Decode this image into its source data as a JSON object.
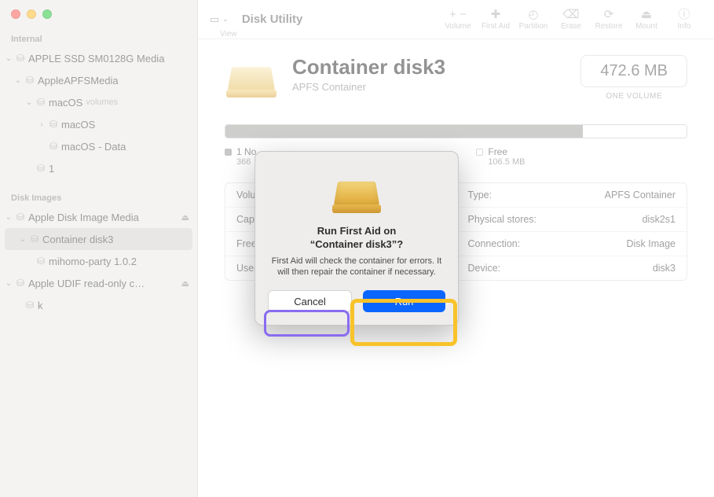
{
  "app_title": "Disk Utility",
  "toolbar": {
    "view_label": "View",
    "items": [
      {
        "id": "volume",
        "label": "Volume",
        "glyph": "+  −"
      },
      {
        "id": "firstaid",
        "label": "First Aid",
        "glyph": "✚"
      },
      {
        "id": "partition",
        "label": "Partition",
        "glyph": "◴"
      },
      {
        "id": "erase",
        "label": "Erase",
        "glyph": "⌫"
      },
      {
        "id": "restore",
        "label": "Restore",
        "glyph": "⟳"
      },
      {
        "id": "mount",
        "label": "Mount",
        "glyph": "⏏"
      },
      {
        "id": "info",
        "label": "Info",
        "glyph": "ⓘ"
      }
    ]
  },
  "sidebar": {
    "internal_label": "Internal",
    "disk_images_label": "Disk Images",
    "internal_items": [
      {
        "label": "APPLE SSD SM0128G Media",
        "indent": 0,
        "has_chev": true,
        "chev": "⌄",
        "ejectable": false,
        "selected": false
      },
      {
        "label": "AppleAPFSMedia",
        "indent": 1,
        "has_chev": true,
        "chev": "⌄",
        "ejectable": false,
        "selected": false
      },
      {
        "label": "macOS",
        "indent": 2,
        "has_chev": true,
        "chev": "⌄",
        "ejectable": false,
        "selected": false,
        "suffix": "volumes"
      },
      {
        "label": "macOS",
        "indent": 3,
        "has_chev": true,
        "chev": "›",
        "ejectable": false,
        "selected": false
      },
      {
        "label": "macOS - Data",
        "indent": 3,
        "has_chev": false,
        "chev": "",
        "ejectable": false,
        "selected": false
      },
      {
        "label": "1",
        "indent": 2,
        "has_chev": false,
        "chev": "",
        "ejectable": false,
        "selected": false
      }
    ],
    "image_items": [
      {
        "label": "Apple Disk Image Media",
        "indent": 0,
        "has_chev": true,
        "chev": "⌄",
        "ejectable": true,
        "selected": false
      },
      {
        "label": "Container disk3",
        "indent": 1,
        "has_chev": true,
        "chev": "⌄",
        "ejectable": false,
        "selected": true
      },
      {
        "label": "mihomo-party 1.0.2",
        "indent": 2,
        "has_chev": false,
        "chev": "",
        "ejectable": false,
        "selected": false
      },
      {
        "label": "Apple UDIF read-only c…",
        "indent": 0,
        "has_chev": true,
        "chev": "⌄",
        "ejectable": true,
        "selected": false
      },
      {
        "label": "k",
        "indent": 1,
        "has_chev": false,
        "chev": "",
        "ejectable": false,
        "selected": false
      }
    ]
  },
  "disk": {
    "name": "Container disk3",
    "subtitle": "APFS Container",
    "size_label": "472.6 MB",
    "volume_count_label": "ONE VOLUME"
  },
  "usage": {
    "used_label_prefix": "1 No",
    "used_value": "366",
    "used_ratio": 0.775,
    "free_label": "Free",
    "free_value": "106.5 MB"
  },
  "details": {
    "rows": [
      {
        "left_key": "Volum",
        "left_val": "",
        "right_key": "Type:",
        "right_val": "APFS Container"
      },
      {
        "left_key": "Capac",
        "left_val": "",
        "right_key": "Physical stores:",
        "right_val": "disk2s1"
      },
      {
        "left_key": "Free:",
        "left_val": "",
        "right_key": "Connection:",
        "right_val": "Disk Image"
      },
      {
        "left_key": "Used:",
        "left_val": "",
        "right_key": "Device:",
        "right_val": "disk3"
      }
    ]
  },
  "modal": {
    "title_line1": "Run First Aid on",
    "title_line2": "“Container disk3”?",
    "description": "First Aid will check the container for errors. It will then repair the container if necessary.",
    "cancel_label": "Cancel",
    "run_label": "Run"
  }
}
